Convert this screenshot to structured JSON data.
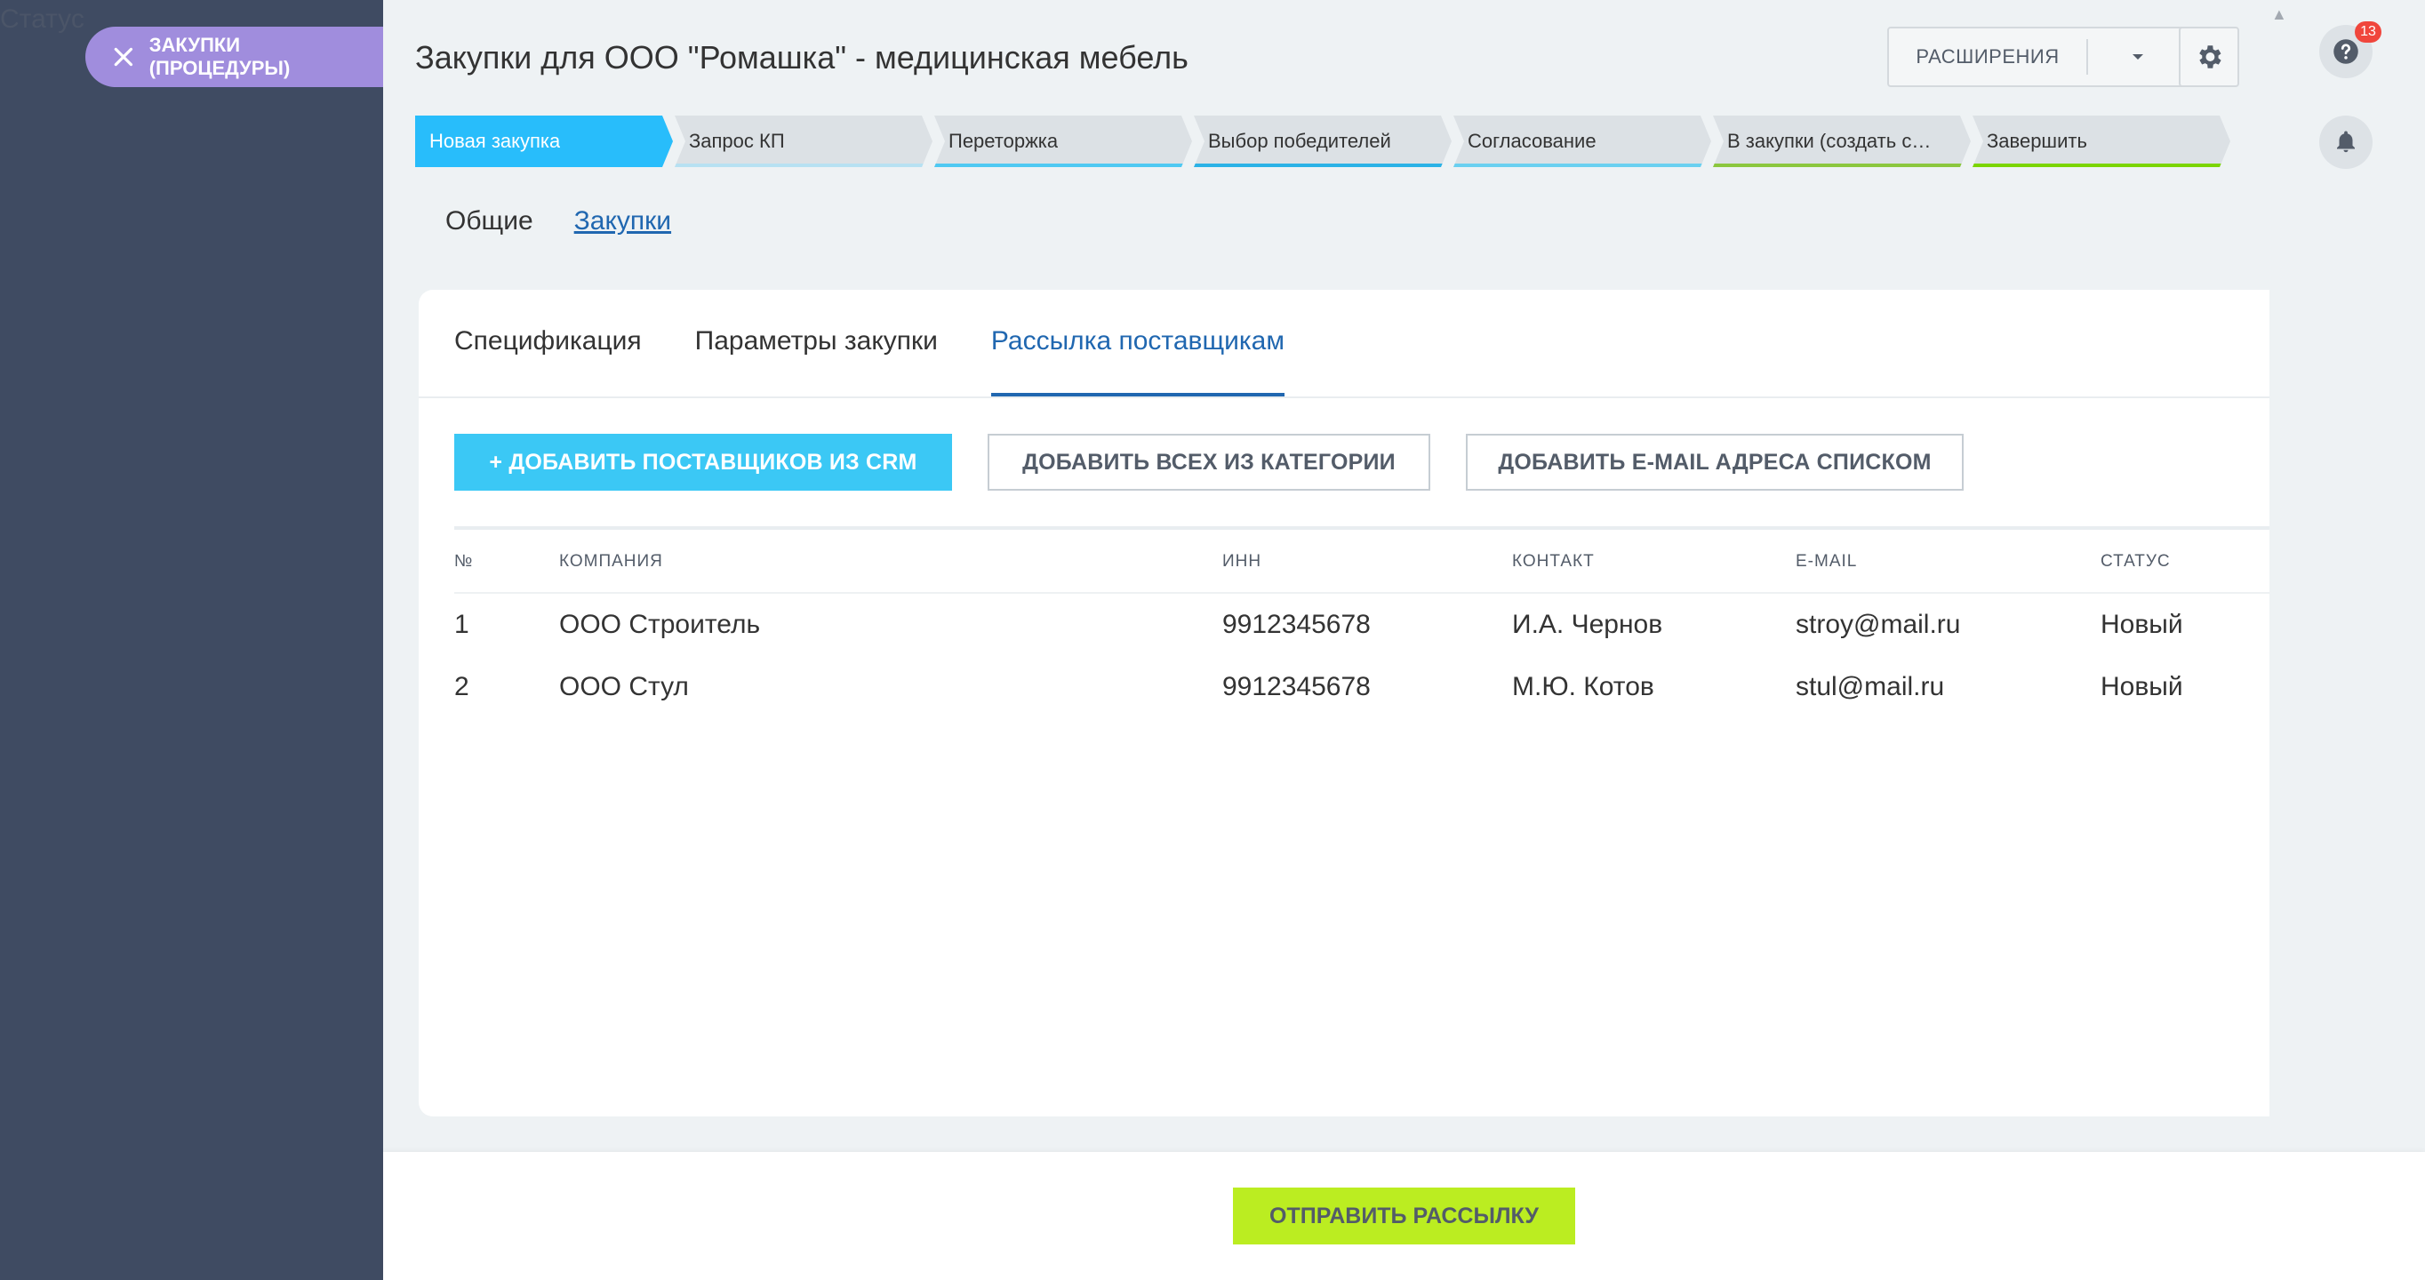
{
  "background_label": "Статус",
  "slider": {
    "close_label": "ЗАКУПКИ (ПРОЦЕДУРЫ)",
    "title": "Закупки для ООО \"Ромашка\" - медицинская мебель"
  },
  "toolbar": {
    "extensions_label": "РАСШИРЕНИЯ",
    "help_badge": "13"
  },
  "stages": [
    {
      "label": "Новая закупка",
      "color": "#28bdfb",
      "active": true
    },
    {
      "label": "Запрос КП",
      "color": "#b7e1f2"
    },
    {
      "label": "Переторжка",
      "color": "#4fc9f2"
    },
    {
      "label": "Выбор победителей",
      "color": "#2bb2e6"
    },
    {
      "label": "Согласование",
      "color": "#6ad0f0"
    },
    {
      "label": "В закупки (создать сде...",
      "color": "#8bc73e"
    },
    {
      "label": "Завершить",
      "color": "#7bd500"
    }
  ],
  "page_tabs": [
    {
      "label": "Общие"
    },
    {
      "label": "Закупки",
      "active": true
    }
  ],
  "card_tabs": [
    {
      "label": "Спецификация"
    },
    {
      "label": "Параметры закупки"
    },
    {
      "label": "Рассылка поставщикам",
      "active": true
    }
  ],
  "actions": {
    "add_from_crm": "+ ДОБАВИТЬ ПОСТАВЩИКОВ ИЗ CRM",
    "add_all_category": "ДОБАВИТЬ ВСЕХ ИЗ КАТЕГОРИИ",
    "add_email_list": "ДОБАВИТЬ E-MAIL АДРЕСА СПИСКОМ"
  },
  "table": {
    "headers": {
      "num": "№",
      "company": "КОМПАНИЯ",
      "inn": "ИНН",
      "contact": "КОНТАКТ",
      "email": "E-MAIL",
      "status": "СТАТУС"
    },
    "rows": [
      {
        "num": "1",
        "company": "ООО Строитель",
        "inn": "9912345678",
        "contact": "И.А. Чернов",
        "email": "stroy@mail.ru",
        "status": "Новый"
      },
      {
        "num": "2",
        "company": "ООО Стул",
        "inn": "9912345678",
        "contact": "М.Ю. Котов",
        "email": "stul@mail.ru",
        "status": "Новый"
      }
    ]
  },
  "footer": {
    "send_label": "ОТПРАВИТЬ РАССЫЛКУ"
  },
  "colors": {
    "accent_blue": "#3bc8f5",
    "link_blue": "#2067b0",
    "send_green": "#bbed21",
    "sidebar_bg": "#3f4b62",
    "close_tab": "#a08ddd"
  }
}
